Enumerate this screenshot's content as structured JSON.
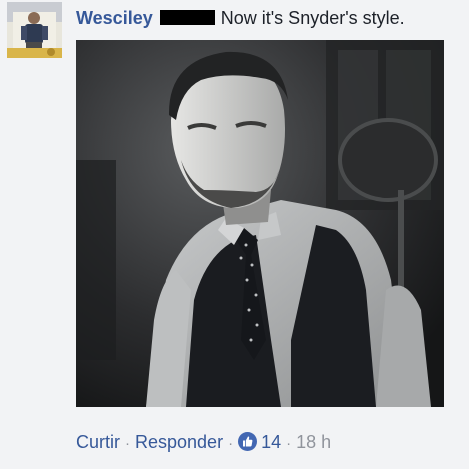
{
  "comment": {
    "author": "Wesciley",
    "text": "Now it's Snyder's style."
  },
  "avatar": {
    "icon": "profile-photo"
  },
  "attachment": {
    "icon": "photo-man-in-vest"
  },
  "actions": {
    "like_label": "Curtir",
    "reply_label": "Responder",
    "separator": "·",
    "reaction_icon": "thumbs-up-icon",
    "likes_count": "14",
    "timestamp": "18 h"
  },
  "colors": {
    "link": "#365899",
    "meta": "#90949c",
    "background": "#f2f3f5",
    "like_badge": "#4267b2"
  }
}
